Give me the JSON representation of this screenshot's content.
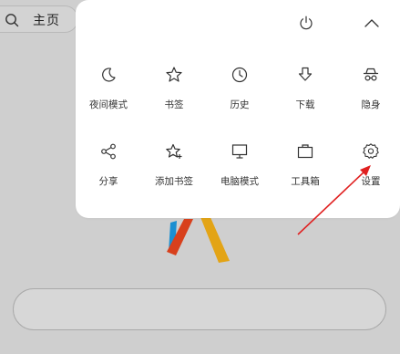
{
  "home": {
    "label": "主页",
    "search_icon": "search-icon"
  },
  "menu": {
    "top_controls": [
      {
        "name": "power-icon"
      },
      {
        "name": "chevron-up-icon"
      }
    ],
    "row1": [
      {
        "label": "夜间模式",
        "icon": "moon-icon"
      },
      {
        "label": "书签",
        "icon": "star-icon"
      },
      {
        "label": "历史",
        "icon": "clock-icon"
      },
      {
        "label": "下载",
        "icon": "download-icon"
      },
      {
        "label": "隐身",
        "icon": "incognito-icon"
      }
    ],
    "row2": [
      {
        "label": "分享",
        "icon": "share-icon"
      },
      {
        "label": "添加书签",
        "icon": "star-add-icon"
      },
      {
        "label": "电脑模式",
        "icon": "monitor-icon"
      },
      {
        "label": "工具箱",
        "icon": "toolbox-icon"
      },
      {
        "label": "设置",
        "icon": "gear-icon"
      }
    ]
  },
  "colors": {
    "annotation_arrow": "#e02020",
    "background": "#cfcfcf",
    "panel": "#ffffff"
  }
}
